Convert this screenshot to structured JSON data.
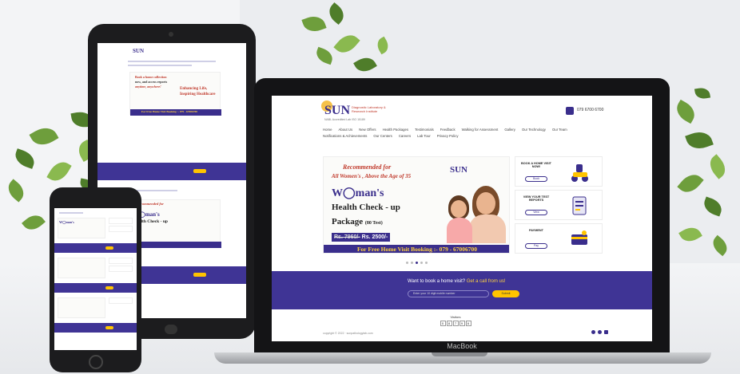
{
  "site": {
    "logo_text": "SUN",
    "logo_tagline": "Diagnostic Laboratory & Research Institute",
    "logo_subline": "NABL Accredited Lab ISO 15189",
    "phone_number": "079 6700 6700",
    "nav": [
      "Home",
      "About Us",
      "New Offers",
      "Health Packages",
      "Testimonials",
      "Feedback",
      "Walking for Assessment",
      "Gallery",
      "Our Technology",
      "Our Team",
      "Notifications & Achievements",
      "Our Centers",
      "Careers",
      "Lab Tour",
      "Privacy Policy"
    ]
  },
  "hero": {
    "line1": "Recommended  for",
    "line2": "All Women's , Above the Age of 35",
    "title": "W◯man's",
    "subtitle": "Health Check - up",
    "package": "Package",
    "package_tests": "(80 Test)",
    "old_price": "Rs. 7960/-",
    "new_price": "Rs. 2500/-",
    "booking": "For Free Home Visit Booking :- 079 - 67006700",
    "logo_text": "SUN"
  },
  "cards": [
    {
      "title": "BOOK A HOME VISIT NOW!",
      "button": "Book",
      "icon": "delivery-scooter-icon"
    },
    {
      "title": "VIEW YOUR TEST REPORTS",
      "button": "View",
      "icon": "report-clipboard-icon"
    },
    {
      "title": "PAYMENT",
      "button": "Pay",
      "icon": "payment-card-icon"
    }
  ],
  "cta": {
    "question": "Want to book a home visit?",
    "highlight": "Get a call from us!",
    "input_placeholder": "Enter your 10 digit mobile number",
    "submit": "Submit"
  },
  "visitors": {
    "label": "Visitors",
    "digits": [
      "0",
      "8",
      "7",
      "9",
      "6"
    ]
  },
  "footer": {
    "copyright": "copyright © 2022 · sunpathologylab.com"
  },
  "device_brand": "MacBook",
  "tablet_banner": {
    "line1": "Book a home collection",
    "line2": "now, and  access reports",
    "line3": "anytime, anywhere!",
    "slogan1": "Enhancing Life,",
    "slogan2": "Inspiring Healthcare",
    "booking": "For Free Home Visit Booking :- 079 - 67006700"
  },
  "colors": {
    "brand": "#3a2e8c",
    "accent": "#ffc400",
    "danger": "#c0392b",
    "band": "#3f3495"
  }
}
